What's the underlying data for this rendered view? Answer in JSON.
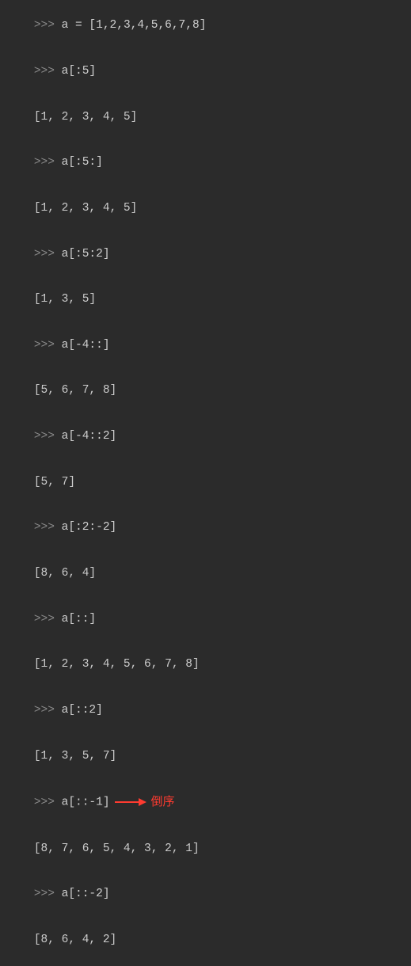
{
  "prompt": ">>>",
  "lines": [
    {
      "type": "input",
      "text": "a = [1,2,3,4,5,6,7,8]"
    },
    {
      "type": "input",
      "text": "a[:5]"
    },
    {
      "type": "output",
      "text": "[1, 2, 3, 4, 5]"
    },
    {
      "type": "input",
      "text": "a[:5:]"
    },
    {
      "type": "output",
      "text": "[1, 2, 3, 4, 5]"
    },
    {
      "type": "input",
      "text": "a[:5:2]"
    },
    {
      "type": "output",
      "text": "[1, 3, 5]"
    },
    {
      "type": "input",
      "text": "a[-4::]"
    },
    {
      "type": "output",
      "text": "[5, 6, 7, 8]"
    },
    {
      "type": "input",
      "text": "a[-4::2]"
    },
    {
      "type": "output",
      "text": "[5, 7]"
    },
    {
      "type": "input",
      "text": "a[:2:-2]"
    },
    {
      "type": "output",
      "text": "[8, 6, 4]"
    },
    {
      "type": "input",
      "text": "a[::]"
    },
    {
      "type": "output",
      "text": "[1, 2, 3, 4, 5, 6, 7, 8]"
    },
    {
      "type": "input",
      "text": "a[::2]"
    },
    {
      "type": "output",
      "text": "[1, 3, 5, 7]"
    },
    {
      "type": "input",
      "text": "a[::-1]",
      "annotated": true
    },
    {
      "type": "output",
      "text": "[8, 7, 6, 5, 4, 3, 2, 1]"
    },
    {
      "type": "input",
      "text": "a[::-2]"
    },
    {
      "type": "output",
      "text": "[8, 6, 4, 2]"
    }
  ],
  "annotation": {
    "text": "倒序",
    "arrow_color": "#ff3b30"
  },
  "colors": {
    "bg": "#2b2b2b",
    "prompt": "#8a8a8a",
    "text": "#cccccc",
    "annotation": "#ff3b30"
  }
}
